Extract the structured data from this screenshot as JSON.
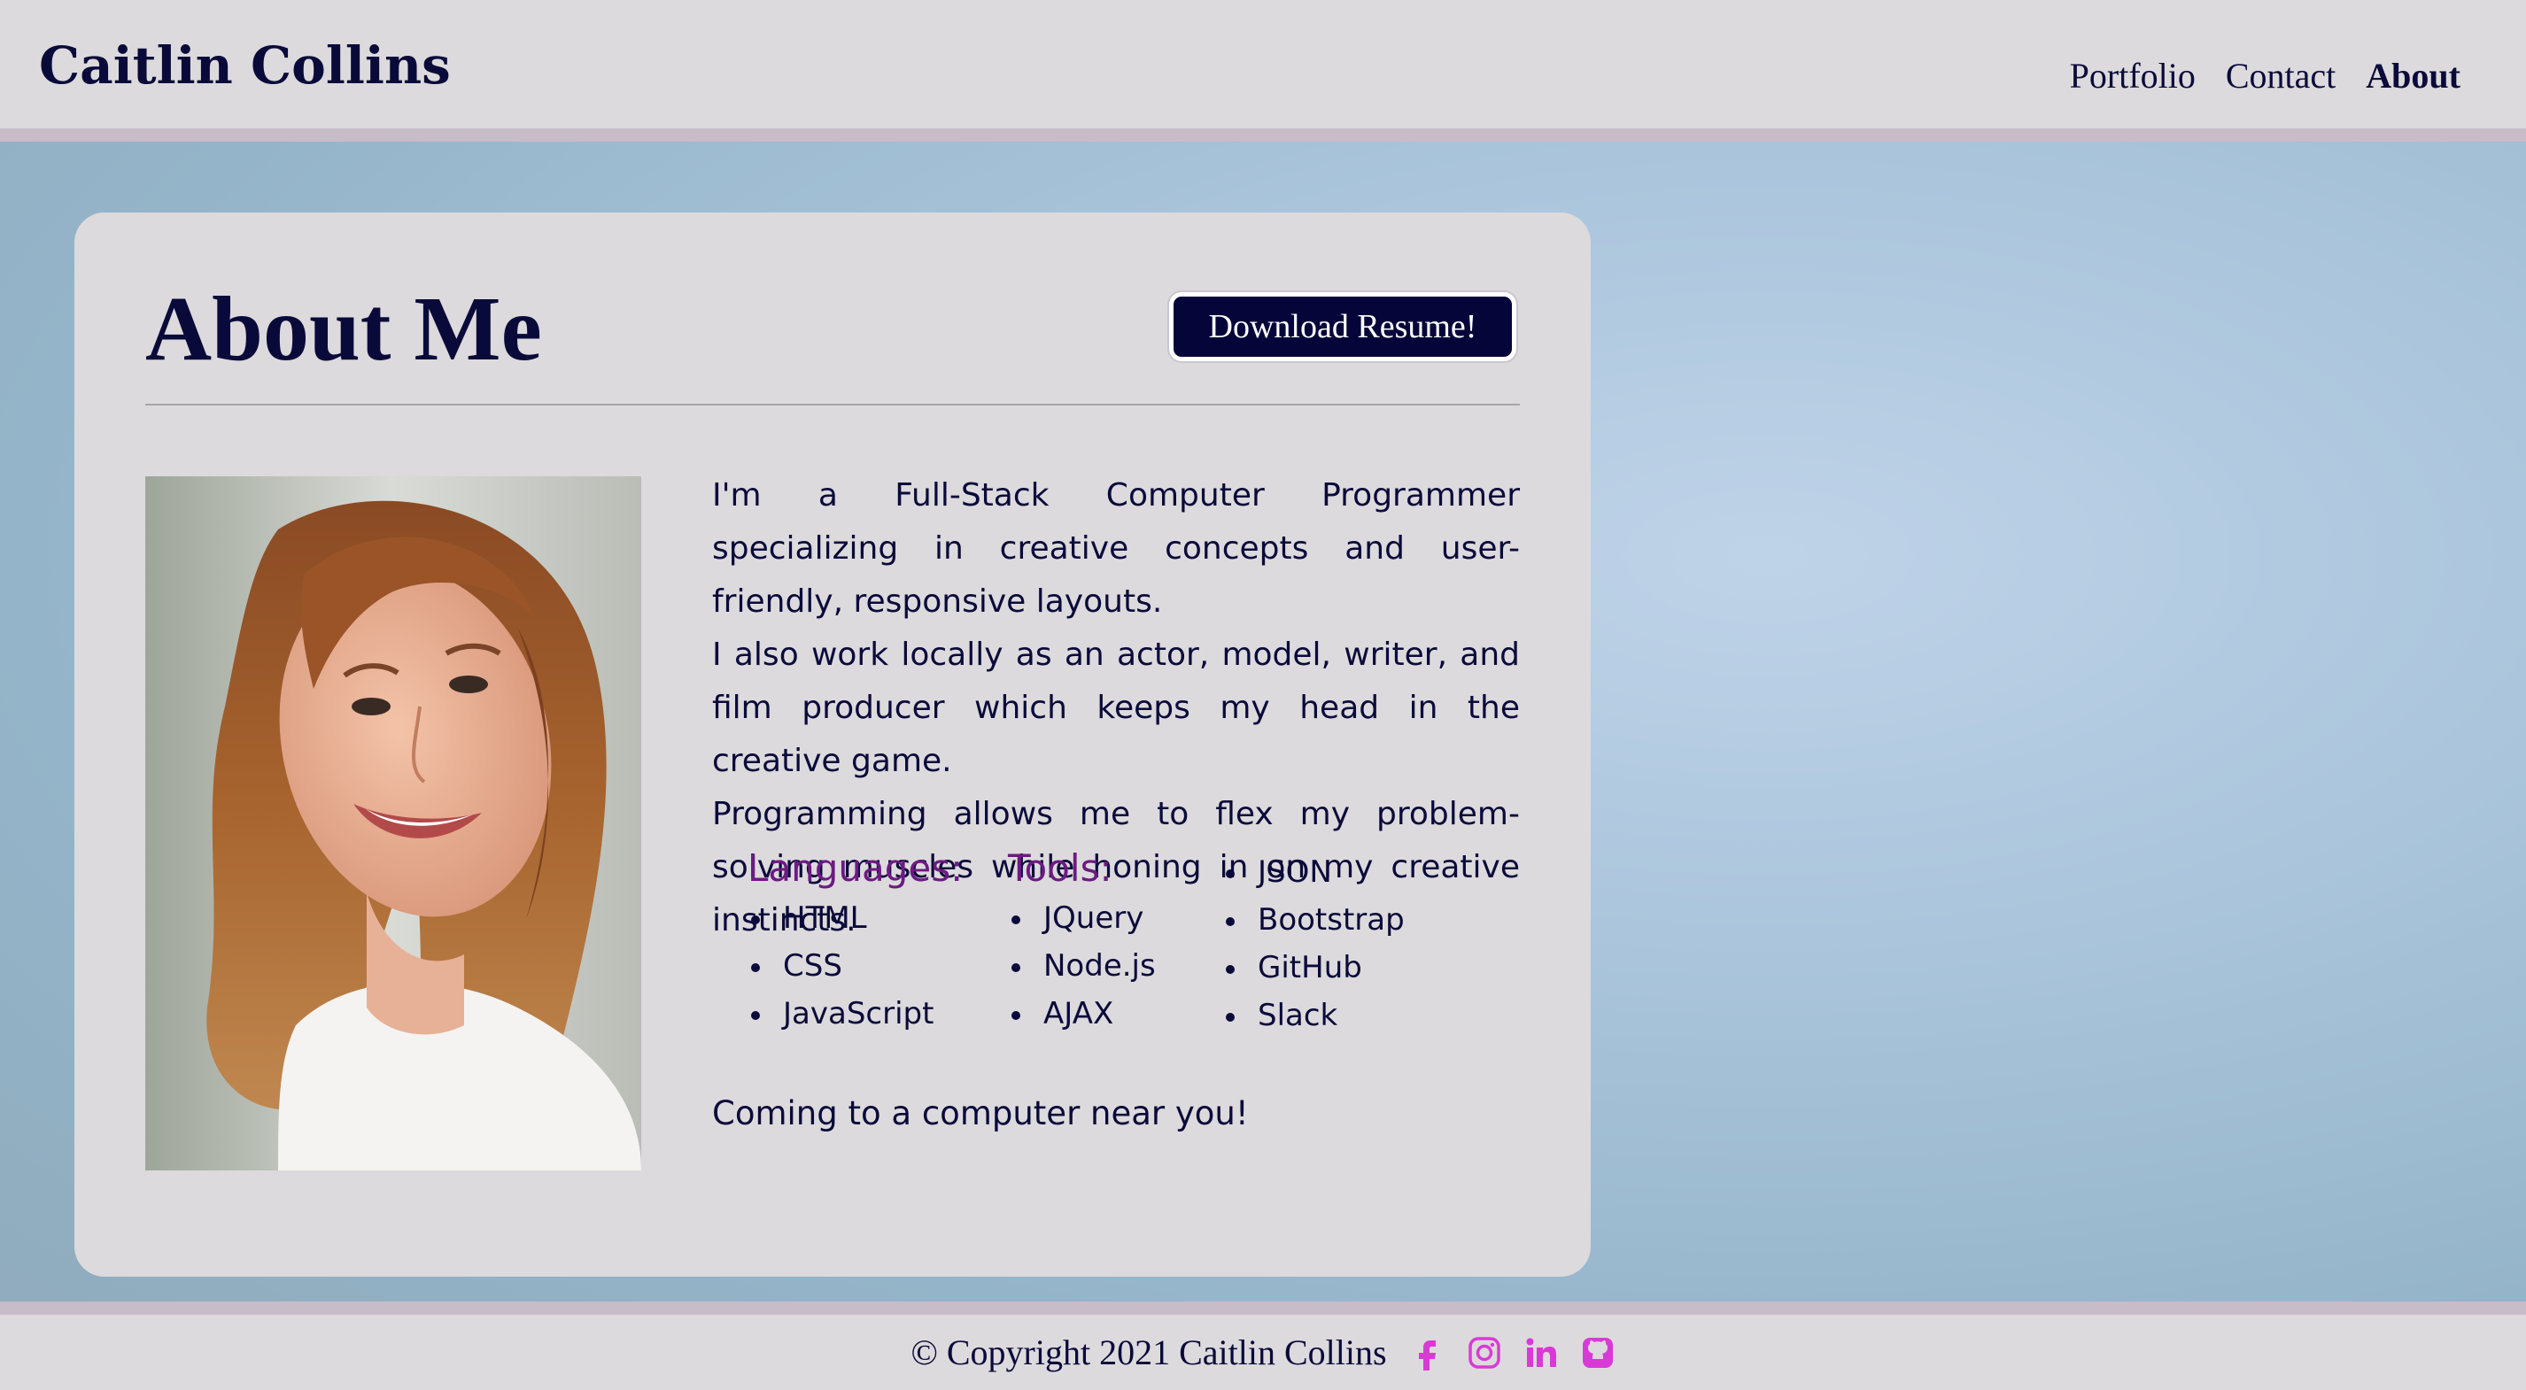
{
  "header": {
    "brand": "Caitlin Collins",
    "nav": [
      {
        "label": "Portfolio"
      },
      {
        "label": "Contact"
      },
      {
        "label": "About",
        "active": true
      }
    ]
  },
  "about": {
    "title": "About Me",
    "resume_button": "Download Resume!",
    "photo_alt": "Portrait photo",
    "bio": [
      "I'm a Full-Stack Computer Programmer specializing in creative concepts and user-friendly, responsive layouts.",
      "I also work locally as an actor, model, writer, and film producer which keeps my head in the creative game.",
      "Programming allows me to flex my problem-solving muscles while honing in on my creative instincts."
    ],
    "languages_heading": "Languages:",
    "languages": [
      "HTML",
      "CSS",
      "JavaScript"
    ],
    "tools_heading": "Tools:",
    "tools": [
      "JQuery",
      "Node.js",
      "AJAX"
    ],
    "tools_more": [
      "JSON",
      "Bootstrap",
      "GitHub",
      "Slack"
    ],
    "closing": "Coming to a computer near you!"
  },
  "footer": {
    "copyright": "© Copyright 2021 Caitlin Collins",
    "social_icons": [
      "facebook-icon",
      "instagram-icon",
      "linkedin-icon",
      "github-icon"
    ]
  },
  "colors": {
    "navy": "#0a0a3a",
    "purple": "#6d1a82",
    "social": "#d93ad6",
    "panel": "#dcdadc"
  }
}
